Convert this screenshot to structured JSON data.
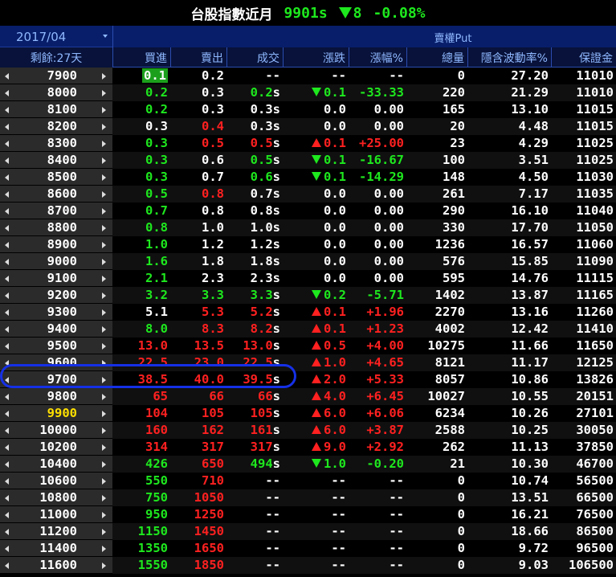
{
  "title": {
    "name": "台股指數近月",
    "index": "9901s",
    "change": "8",
    "pct": "-0.08%"
  },
  "header": {
    "month": "2017/04",
    "remaining": "剩餘:27天",
    "put_label": "賣權Put",
    "columns": [
      "買進",
      "賣出",
      "成交",
      "漲跌",
      "漲幅%",
      "總量",
      "隱含波動率%",
      "保證金"
    ]
  },
  "colors": {
    "up": "#ff2020",
    "down": "#1ee81e",
    "flat": "#ffffff",
    "highlight_strike": "#ffe000",
    "bid_box": "#1ca01c"
  },
  "rows": [
    {
      "strike": "7900",
      "bid": "0.1",
      "bid_c": "box",
      "ask": "0.2",
      "ask_c": "w",
      "trade": "--",
      "trade_c": "w",
      "s": "",
      "dir": "",
      "chg": "--",
      "chg_c": "w",
      "pct": "--",
      "pct_c": "w",
      "vol": "0",
      "iv": "27.20",
      "margin": "11010"
    },
    {
      "strike": "8000",
      "bid": "0.2",
      "bid_c": "g",
      "ask": "0.3",
      "ask_c": "w",
      "trade": "0.2",
      "trade_c": "g",
      "s": "s",
      "dir": "down",
      "chg": "0.1",
      "chg_c": "g",
      "pct": "-33.33",
      "pct_c": "g",
      "vol": "220",
      "iv": "21.29",
      "margin": "11010"
    },
    {
      "strike": "8100",
      "bid": "0.2",
      "bid_c": "g",
      "ask": "0.3",
      "ask_c": "w",
      "trade": "0.3",
      "trade_c": "w",
      "s": "s",
      "dir": "",
      "chg": "0.0",
      "chg_c": "w",
      "pct": "0.00",
      "pct_c": "w",
      "vol": "165",
      "iv": "13.10",
      "margin": "11015"
    },
    {
      "strike": "8200",
      "bid": "0.3",
      "bid_c": "w",
      "ask": "0.4",
      "ask_c": "r",
      "trade": "0.3",
      "trade_c": "w",
      "s": "s",
      "dir": "",
      "chg": "0.0",
      "chg_c": "w",
      "pct": "0.00",
      "pct_c": "w",
      "vol": "20",
      "iv": "4.48",
      "margin": "11015"
    },
    {
      "strike": "8300",
      "bid": "0.3",
      "bid_c": "g",
      "ask": "0.5",
      "ask_c": "r",
      "trade": "0.5",
      "trade_c": "r",
      "s": "s",
      "dir": "up",
      "chg": "0.1",
      "chg_c": "r",
      "pct": "+25.00",
      "pct_c": "r",
      "vol": "23",
      "iv": "4.29",
      "margin": "11025"
    },
    {
      "strike": "8400",
      "bid": "0.3",
      "bid_c": "g",
      "ask": "0.6",
      "ask_c": "w",
      "trade": "0.5",
      "trade_c": "g",
      "s": "s",
      "dir": "down",
      "chg": "0.1",
      "chg_c": "g",
      "pct": "-16.67",
      "pct_c": "g",
      "vol": "100",
      "iv": "3.51",
      "margin": "11025"
    },
    {
      "strike": "8500",
      "bid": "0.3",
      "bid_c": "g",
      "ask": "0.7",
      "ask_c": "w",
      "trade": "0.6",
      "trade_c": "g",
      "s": "s",
      "dir": "down",
      "chg": "0.1",
      "chg_c": "g",
      "pct": "-14.29",
      "pct_c": "g",
      "vol": "148",
      "iv": "4.50",
      "margin": "11030"
    },
    {
      "strike": "8600",
      "bid": "0.5",
      "bid_c": "g",
      "ask": "0.8",
      "ask_c": "r",
      "trade": "0.7",
      "trade_c": "w",
      "s": "s",
      "dir": "",
      "chg": "0.0",
      "chg_c": "w",
      "pct": "0.00",
      "pct_c": "w",
      "vol": "261",
      "iv": "7.17",
      "margin": "11035"
    },
    {
      "strike": "8700",
      "bid": "0.7",
      "bid_c": "g",
      "ask": "0.8",
      "ask_c": "w",
      "trade": "0.8",
      "trade_c": "w",
      "s": "s",
      "dir": "",
      "chg": "0.0",
      "chg_c": "w",
      "pct": "0.00",
      "pct_c": "w",
      "vol": "290",
      "iv": "16.10",
      "margin": "11040"
    },
    {
      "strike": "8800",
      "bid": "0.8",
      "bid_c": "g",
      "ask": "1.0",
      "ask_c": "w",
      "trade": "1.0",
      "trade_c": "w",
      "s": "s",
      "dir": "",
      "chg": "0.0",
      "chg_c": "w",
      "pct": "0.00",
      "pct_c": "w",
      "vol": "330",
      "iv": "17.70",
      "margin": "11050"
    },
    {
      "strike": "8900",
      "bid": "1.0",
      "bid_c": "g",
      "ask": "1.2",
      "ask_c": "w",
      "trade": "1.2",
      "trade_c": "w",
      "s": "s",
      "dir": "",
      "chg": "0.0",
      "chg_c": "w",
      "pct": "0.00",
      "pct_c": "w",
      "vol": "1236",
      "iv": "16.57",
      "margin": "11060"
    },
    {
      "strike": "9000",
      "bid": "1.6",
      "bid_c": "g",
      "ask": "1.8",
      "ask_c": "w",
      "trade": "1.8",
      "trade_c": "w",
      "s": "s",
      "dir": "",
      "chg": "0.0",
      "chg_c": "w",
      "pct": "0.00",
      "pct_c": "w",
      "vol": "576",
      "iv": "15.85",
      "margin": "11090"
    },
    {
      "strike": "9100",
      "bid": "2.1",
      "bid_c": "g",
      "ask": "2.3",
      "ask_c": "w",
      "trade": "2.3",
      "trade_c": "w",
      "s": "s",
      "dir": "",
      "chg": "0.0",
      "chg_c": "w",
      "pct": "0.00",
      "pct_c": "w",
      "vol": "595",
      "iv": "14.76",
      "margin": "11115"
    },
    {
      "strike": "9200",
      "bid": "3.2",
      "bid_c": "g",
      "ask": "3.3",
      "ask_c": "g",
      "trade": "3.3",
      "trade_c": "g",
      "s": "s",
      "dir": "down",
      "chg": "0.2",
      "chg_c": "g",
      "pct": "-5.71",
      "pct_c": "g",
      "vol": "1402",
      "iv": "13.87",
      "margin": "11165"
    },
    {
      "strike": "9300",
      "bid": "5.1",
      "bid_c": "w",
      "ask": "5.3",
      "ask_c": "r",
      "trade": "5.2",
      "trade_c": "r",
      "s": "s",
      "dir": "up",
      "chg": "0.1",
      "chg_c": "r",
      "pct": "+1.96",
      "pct_c": "r",
      "vol": "2270",
      "iv": "13.16",
      "margin": "11260"
    },
    {
      "strike": "9400",
      "bid": "8.0",
      "bid_c": "g",
      "ask": "8.3",
      "ask_c": "r",
      "trade": "8.2",
      "trade_c": "r",
      "s": "s",
      "dir": "up",
      "chg": "0.1",
      "chg_c": "r",
      "pct": "+1.23",
      "pct_c": "r",
      "vol": "4002",
      "iv": "12.42",
      "margin": "11410"
    },
    {
      "strike": "9500",
      "bid": "13.0",
      "bid_c": "r",
      "ask": "13.5",
      "ask_c": "r",
      "trade": "13.0",
      "trade_c": "r",
      "s": "s",
      "dir": "up",
      "chg": "0.5",
      "chg_c": "r",
      "pct": "+4.00",
      "pct_c": "r",
      "vol": "10275",
      "iv": "11.66",
      "margin": "11650"
    },
    {
      "strike": "9600",
      "bid": "22.5",
      "bid_c": "r",
      "ask": "23.0",
      "ask_c": "r",
      "trade": "22.5",
      "trade_c": "r",
      "s": "s",
      "dir": "up",
      "chg": "1.0",
      "chg_c": "r",
      "pct": "+4.65",
      "pct_c": "r",
      "vol": "8121",
      "iv": "11.17",
      "margin": "12125"
    },
    {
      "strike": "9700",
      "bid": "38.5",
      "bid_c": "r",
      "ask": "40.0",
      "ask_c": "r",
      "trade": "39.5",
      "trade_c": "r",
      "s": "s",
      "dir": "up",
      "chg": "2.0",
      "chg_c": "r",
      "pct": "+5.33",
      "pct_c": "r",
      "vol": "8057",
      "iv": "10.86",
      "margin": "13826"
    },
    {
      "strike": "9800",
      "bid": "65",
      "bid_c": "r",
      "ask": "66",
      "ask_c": "r",
      "trade": "66",
      "trade_c": "r",
      "s": "s",
      "dir": "up",
      "chg": "4.0",
      "chg_c": "r",
      "pct": "+6.45",
      "pct_c": "r",
      "vol": "10027",
      "iv": "10.55",
      "margin": "20151"
    },
    {
      "strike": "9900",
      "strike_c": "y",
      "bid": "104",
      "bid_c": "r",
      "ask": "105",
      "ask_c": "r",
      "trade": "105",
      "trade_c": "r",
      "s": "s",
      "dir": "up",
      "chg": "6.0",
      "chg_c": "r",
      "pct": "+6.06",
      "pct_c": "r",
      "vol": "6234",
      "iv": "10.26",
      "margin": "27101"
    },
    {
      "strike": "10000",
      "bid": "160",
      "bid_c": "r",
      "ask": "162",
      "ask_c": "r",
      "trade": "161",
      "trade_c": "r",
      "s": "s",
      "dir": "up",
      "chg": "6.0",
      "chg_c": "r",
      "pct": "+3.87",
      "pct_c": "r",
      "vol": "2588",
      "iv": "10.25",
      "margin": "30050"
    },
    {
      "strike": "10200",
      "bid": "314",
      "bid_c": "r",
      "ask": "317",
      "ask_c": "r",
      "trade": "317",
      "trade_c": "r",
      "s": "s",
      "dir": "up",
      "chg": "9.0",
      "chg_c": "r",
      "pct": "+2.92",
      "pct_c": "r",
      "vol": "262",
      "iv": "11.13",
      "margin": "37850"
    },
    {
      "strike": "10400",
      "bid": "426",
      "bid_c": "g",
      "ask": "650",
      "ask_c": "r",
      "trade": "494",
      "trade_c": "g",
      "s": "s",
      "dir": "down",
      "chg": "1.0",
      "chg_c": "g",
      "pct": "-0.20",
      "pct_c": "g",
      "vol": "21",
      "iv": "10.30",
      "margin": "46700"
    },
    {
      "strike": "10600",
      "bid": "550",
      "bid_c": "g",
      "ask": "710",
      "ask_c": "r",
      "trade": "--",
      "trade_c": "w",
      "s": "",
      "dir": "",
      "chg": "--",
      "chg_c": "w",
      "pct": "--",
      "pct_c": "w",
      "vol": "0",
      "iv": "10.74",
      "margin": "56500"
    },
    {
      "strike": "10800",
      "bid": "750",
      "bid_c": "g",
      "ask": "1050",
      "ask_c": "r",
      "trade": "--",
      "trade_c": "w",
      "s": "",
      "dir": "",
      "chg": "--",
      "chg_c": "w",
      "pct": "--",
      "pct_c": "w",
      "vol": "0",
      "iv": "13.51",
      "margin": "66500"
    },
    {
      "strike": "11000",
      "bid": "950",
      "bid_c": "g",
      "ask": "1250",
      "ask_c": "r",
      "trade": "--",
      "trade_c": "w",
      "s": "",
      "dir": "",
      "chg": "--",
      "chg_c": "w",
      "pct": "--",
      "pct_c": "w",
      "vol": "0",
      "iv": "16.21",
      "margin": "76500"
    },
    {
      "strike": "11200",
      "bid": "1150",
      "bid_c": "g",
      "ask": "1450",
      "ask_c": "r",
      "trade": "--",
      "trade_c": "w",
      "s": "",
      "dir": "",
      "chg": "--",
      "chg_c": "w",
      "pct": "--",
      "pct_c": "w",
      "vol": "0",
      "iv": "18.66",
      "margin": "86500"
    },
    {
      "strike": "11400",
      "bid": "1350",
      "bid_c": "g",
      "ask": "1650",
      "ask_c": "r",
      "trade": "--",
      "trade_c": "w",
      "s": "",
      "dir": "",
      "chg": "--",
      "chg_c": "w",
      "pct": "--",
      "pct_c": "w",
      "vol": "0",
      "iv": "9.72",
      "margin": "96500"
    },
    {
      "strike": "11600",
      "bid": "1550",
      "bid_c": "g",
      "ask": "1850",
      "ask_c": "r",
      "trade": "--",
      "trade_c": "w",
      "s": "",
      "dir": "",
      "chg": "--",
      "chg_c": "w",
      "pct": "--",
      "pct_c": "w",
      "vol": "0",
      "iv": "9.03",
      "margin": "106500"
    }
  ]
}
